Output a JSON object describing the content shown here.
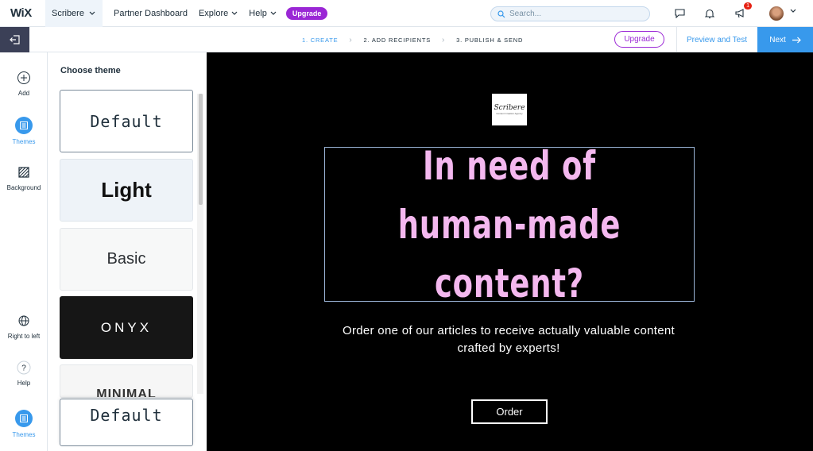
{
  "topbar": {
    "logo": "WiX",
    "site_name": "Scribere",
    "nav": [
      "Partner Dashboard",
      "Explore",
      "Help"
    ],
    "upgrade_pill": "Upgrade",
    "search_placeholder": "Search...",
    "notification_count": "1"
  },
  "subbar": {
    "steps": [
      "1. CREATE",
      "2. ADD RECIPIENTS",
      "3. PUBLISH & SEND"
    ],
    "upgrade_label": "Upgrade",
    "preview_label": "Preview and Test",
    "next_label": "Next"
  },
  "leftrail": {
    "items": [
      "Add",
      "Themes",
      "Background",
      "Right to left",
      "Help",
      "Themes"
    ]
  },
  "panel": {
    "title": "Choose theme",
    "themes": [
      "Default",
      "Light",
      "Basic",
      "ONYX",
      "MINIMAL",
      "Default"
    ]
  },
  "canvas": {
    "logo_text": "Scribere",
    "logo_subtext": "Content Creation Agency",
    "headline": "In need of human-made content?",
    "body": "Order one of our articles to receive actually valuable content crafted by experts!",
    "button": "Order"
  },
  "colors": {
    "accent": "#3899ec",
    "upgrade": "#9a27d5",
    "headline": "#f4b8ef",
    "canvas_bg": "#000000"
  }
}
